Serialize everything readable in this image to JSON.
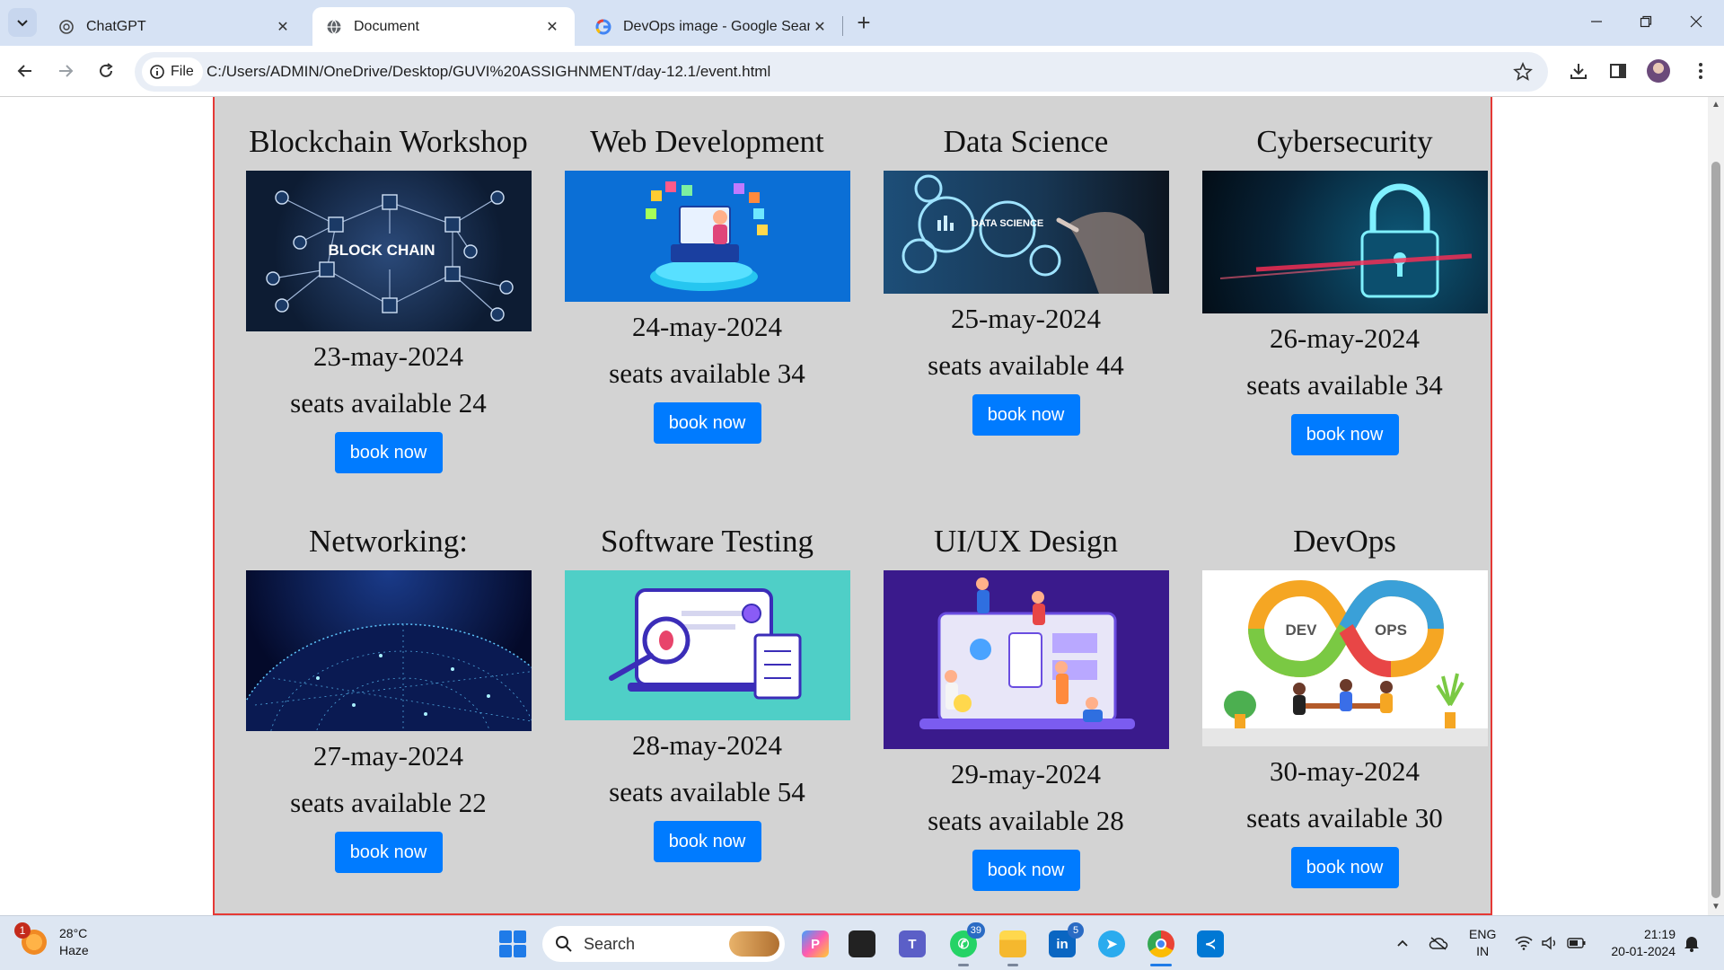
{
  "browser": {
    "tabs": [
      {
        "title": "ChatGPT",
        "favicon": "chatgpt-icon"
      },
      {
        "title": "Document",
        "favicon": "globe-icon",
        "active": true
      },
      {
        "title": "DevOps image - Google Search",
        "favicon": "google-icon"
      }
    ],
    "new_tab_label": "+",
    "file_chip": "File",
    "url": "C:/Users/ADMIN/OneDrive/Desktop/GUVI%20ASSIGHNMENT/day-12.1/event.html"
  },
  "page": {
    "border_color": "#e53935",
    "background": "#d3d3d3",
    "button_color": "#007bff",
    "events": [
      {
        "title": "Blockchain Workshop",
        "date": "23-may-2024",
        "seats": "seats available 24",
        "button": "book now",
        "image_label": "BLOCK CHAIN"
      },
      {
        "title": "Web Development",
        "date": "24-may-2024",
        "seats": "seats available 34",
        "button": "book now"
      },
      {
        "title": "Data Science",
        "date": "25-may-2024",
        "seats": "seats available 44",
        "button": "book now",
        "image_label": "DATA SCIENCE"
      },
      {
        "title": "Cybersecurity",
        "date": "26-may-2024",
        "seats": "seats available 34",
        "button": "book now"
      },
      {
        "title": "Networking:",
        "date": "27-may-2024",
        "seats": "seats available 22",
        "button": "book now"
      },
      {
        "title": "Software Testing",
        "date": "28-may-2024",
        "seats": "seats available 54",
        "button": "book now"
      },
      {
        "title": "UI/UX Design",
        "date": "29-may-2024",
        "seats": "seats available 28",
        "button": "book now"
      },
      {
        "title": "DevOps",
        "date": "30-may-2024",
        "seats": "seats available 30",
        "button": "book now",
        "image_labels": [
          "DEV",
          "OPS"
        ]
      }
    ]
  },
  "taskbar": {
    "weather_temp": "28°C",
    "weather_desc": "Haze",
    "weather_badge": "1",
    "search_label": "Search",
    "whatsapp_badge": "39",
    "linkedin_badge": "5",
    "lang_primary": "ENG",
    "lang_secondary": "IN",
    "time": "21:19",
    "date": "20-01-2024"
  }
}
